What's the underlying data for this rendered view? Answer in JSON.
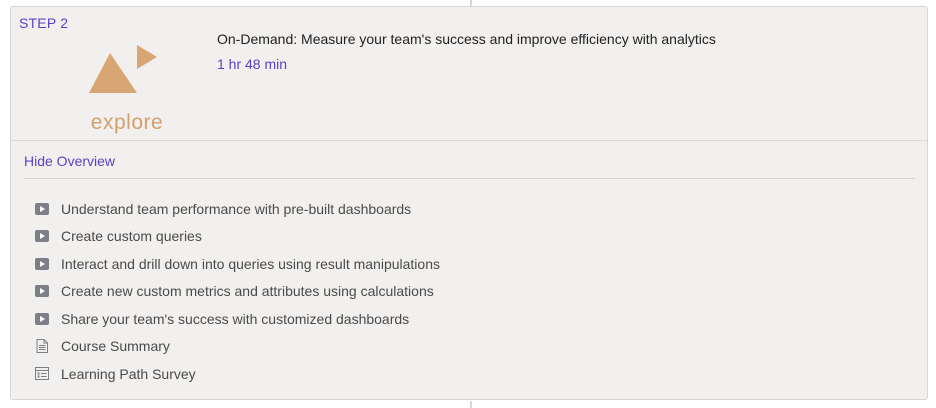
{
  "step": {
    "label": "STEP 2"
  },
  "logo": {
    "text": "explore",
    "icon": "explore-triangles-icon",
    "color": "#d2a06c"
  },
  "course": {
    "title": "On-Demand: Measure your team's success and improve efficiency with analytics",
    "duration": "1 hr 48 min"
  },
  "overview": {
    "toggle_label": "Hide Overview",
    "items": [
      {
        "label": "Understand team performance with pre-built dashboards",
        "icon": "video-play-icon"
      },
      {
        "label": "Create custom queries",
        "icon": "video-play-icon"
      },
      {
        "label": "Interact and drill down into queries using result manipulations",
        "icon": "video-play-icon"
      },
      {
        "label": "Create new custom metrics and attributes using calculations",
        "icon": "video-play-icon"
      },
      {
        "label": "Share your team's success with customized dashboards",
        "icon": "video-play-icon"
      },
      {
        "label": "Course Summary",
        "icon": "document-icon"
      },
      {
        "label": "Learning Path Survey",
        "icon": "survey-icon"
      }
    ]
  },
  "colors": {
    "accent": "#5b3fc4",
    "card_bg": "#f2f0ee",
    "icon_gray": "#7d7f86"
  }
}
